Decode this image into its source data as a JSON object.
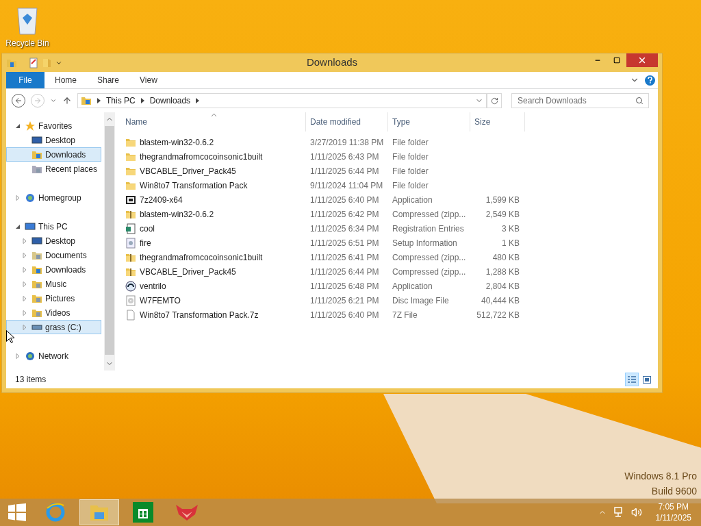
{
  "desktop_icons": [
    {
      "label": "Recycle Bin"
    }
  ],
  "window": {
    "title": "Downloads",
    "ribbon_tabs": [
      {
        "label": "File",
        "kind": "file"
      },
      {
        "label": "Home",
        "kind": "tab"
      },
      {
        "label": "Share",
        "kind": "tab"
      },
      {
        "label": "View",
        "kind": "tab"
      }
    ],
    "address": {
      "path": [
        "This PC",
        "Downloads"
      ]
    },
    "search": {
      "placeholder": "Search Downloads"
    },
    "nav_tree": [
      {
        "label": "Favorites",
        "kind": "star",
        "expanded": true,
        "selected": false,
        "children": [
          {
            "label": "Desktop",
            "kind": "desktop",
            "selected": false
          },
          {
            "label": "Downloads",
            "kind": "downloads",
            "selected": true
          },
          {
            "label": "Recent places",
            "kind": "recent",
            "selected": false
          }
        ]
      },
      {
        "label": "Homegroup",
        "kind": "homegroup",
        "expanded": false,
        "selected": false
      },
      {
        "label": "This PC",
        "kind": "pc",
        "expanded": true,
        "selected": false,
        "children": [
          {
            "label": "Desktop",
            "kind": "desktop",
            "expanded": false,
            "selected": false
          },
          {
            "label": "Documents",
            "kind": "documents",
            "expanded": false,
            "selected": false
          },
          {
            "label": "Downloads",
            "kind": "downloads",
            "expanded": false,
            "selected": false
          },
          {
            "label": "Music",
            "kind": "music",
            "expanded": false,
            "selected": false
          },
          {
            "label": "Pictures",
            "kind": "pictures",
            "expanded": false,
            "selected": false
          },
          {
            "label": "Videos",
            "kind": "videos",
            "expanded": false,
            "selected": false
          },
          {
            "label": "grass (C:)",
            "kind": "drive",
            "expanded": false,
            "selected": true
          }
        ]
      },
      {
        "label": "Network",
        "kind": "network",
        "expanded": false,
        "selected": false
      }
    ],
    "columns": [
      "Name",
      "Date modified",
      "Type",
      "Size"
    ],
    "rows": [
      {
        "kind": "folder",
        "name": "blastem-win32-0.6.2",
        "date": "3/27/2019 11:38 PM",
        "type": "File folder"
      },
      {
        "kind": "folder",
        "name": "thegrandmafromcocoinsonic1built",
        "date": "1/11/2025 6:43 PM",
        "type": "File folder"
      },
      {
        "kind": "folder",
        "name": "VBCABLE_Driver_Pack45",
        "date": "1/11/2025 6:44 PM",
        "type": "File folder"
      },
      {
        "kind": "folder",
        "name": "Win8to7 Transformation Pack",
        "date": "9/11/2024 11:04 PM",
        "type": "File folder"
      },
      {
        "kind": "app7z",
        "name": "7z2409-x64",
        "date": "1/11/2025 6:40 PM",
        "type": "Application",
        "size": "1,599 KB"
      },
      {
        "kind": "zip",
        "name": "blastem-win32-0.6.2",
        "date": "1/11/2025 6:42 PM",
        "type": "Compressed (zipp...",
        "size": "2,549 KB"
      },
      {
        "kind": "reg",
        "name": "cool",
        "date": "1/11/2025 6:34 PM",
        "type": "Registration Entries",
        "size": "3 KB"
      },
      {
        "kind": "inf",
        "name": "fire",
        "date": "1/11/2025 6:51 PM",
        "type": "Setup Information",
        "size": "1 KB"
      },
      {
        "kind": "zip",
        "name": "thegrandmafromcocoinsonic1built",
        "date": "1/11/2025 6:41 PM",
        "type": "Compressed (zipp...",
        "size": "480 KB"
      },
      {
        "kind": "zip",
        "name": "VBCABLE_Driver_Pack45",
        "date": "1/11/2025 6:44 PM",
        "type": "Compressed (zipp...",
        "size": "1,288 KB"
      },
      {
        "kind": "headset",
        "name": "ventrilo",
        "date": "1/11/2025 6:48 PM",
        "type": "Application",
        "size": "2,804 KB"
      },
      {
        "kind": "disc",
        "name": "W7FEMTO",
        "date": "1/11/2025 6:21 PM",
        "type": "Disc Image File",
        "size": "40,444 KB"
      },
      {
        "kind": "file",
        "name": "Win8to7 Transformation Pack.7z",
        "date": "1/11/2025 6:40 PM",
        "type": "7Z File",
        "size": "512,722 KB"
      }
    ],
    "status": "13 items",
    "views": [
      {
        "kind": "details",
        "selected": true
      },
      {
        "kind": "thumbnails",
        "selected": false
      }
    ]
  },
  "watermark": [
    "Windows 8.1 Pro",
    "Build 9600"
  ],
  "taskbar": {
    "apps": [
      {
        "kind": "ie",
        "selected": false
      },
      {
        "kind": "explorer",
        "selected": true
      },
      {
        "kind": "store",
        "selected": false
      },
      {
        "kind": "fox",
        "selected": false
      }
    ],
    "time": "7:05 PM",
    "date": "1/11/2025"
  }
}
